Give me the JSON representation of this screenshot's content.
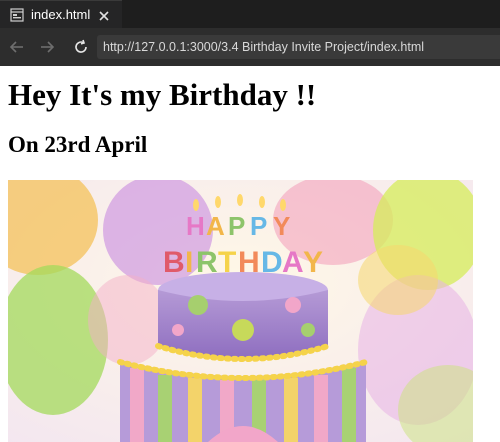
{
  "tab": {
    "title": "index.html",
    "icon": "file-preview-icon"
  },
  "toolbar": {
    "url": "http://127.0.0.1:3000/3.4 Birthday Invite Project/index.html"
  },
  "page": {
    "heading": "Hey It's my Birthday !!",
    "subheading": "On 23rd April",
    "image": {
      "description_icon": "birthday-cake-image",
      "candle_letters_top": "HAPPY",
      "candle_letters_bottom": "BIRTHDAY"
    }
  },
  "colors": {
    "chrome_bg": "#1e1e1e",
    "toolbar_bg": "#2d2d2d",
    "urlbar_bg": "#3a3a3a",
    "page_bg": "#ffffff"
  }
}
